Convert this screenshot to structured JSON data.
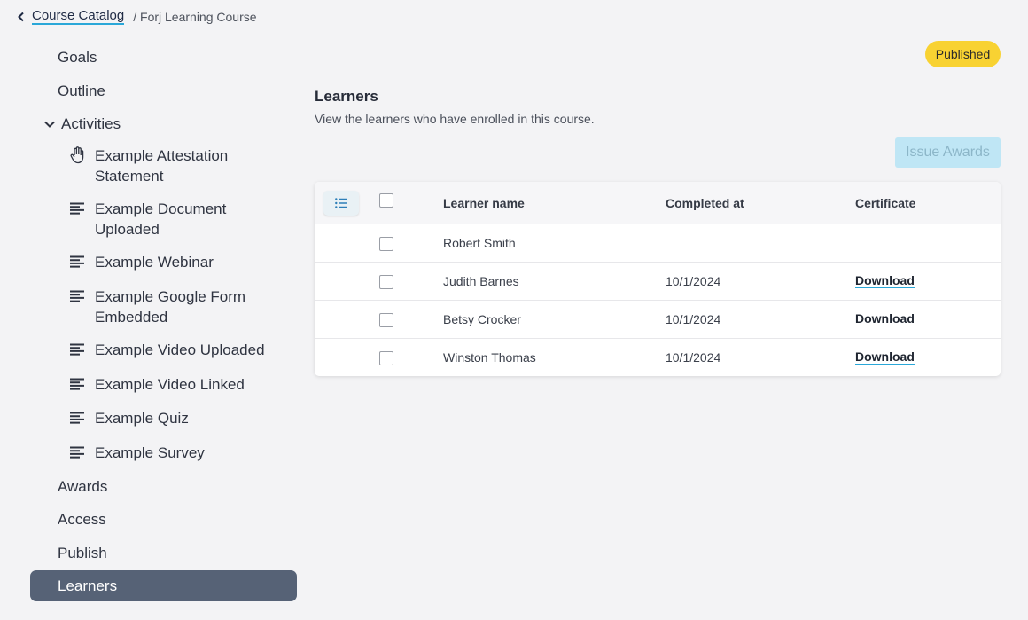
{
  "breadcrumb": {
    "parent": "Course Catalog",
    "current": "/ Forj Learning Course"
  },
  "status_badge": "Published",
  "nav": {
    "goals": "Goals",
    "outline": "Outline",
    "activities": "Activities",
    "activity_items": [
      "Example Attestation Statement",
      "Example Document Uploaded",
      "Example Webinar",
      "Example Google Form Embedded",
      "Example Video Uploaded",
      "Example Video Linked",
      "Example Quiz",
      "Example Survey"
    ],
    "awards": "Awards",
    "access": "Access",
    "publish": "Publish",
    "learners": "Learners"
  },
  "main": {
    "title": "Learners",
    "subtitle": "View the learners who have enrolled in this course.",
    "issue_awards": "Issue Awards"
  },
  "table": {
    "headers": [
      "Learner name",
      "Completed at",
      "Certificate"
    ],
    "rows": [
      {
        "name": "Robert Smith",
        "completed": "",
        "certificate": ""
      },
      {
        "name": "Judith Barnes",
        "completed": "10/1/2024",
        "certificate": "Download"
      },
      {
        "name": "Betsy Crocker",
        "completed": "10/1/2024",
        "certificate": "Download"
      },
      {
        "name": "Winston Thomas",
        "completed": "10/1/2024",
        "certificate": "Download"
      }
    ]
  },
  "colors": {
    "accent": "#2aa7d8",
    "active_nav": "#566276",
    "badge": "#f8d232",
    "award_button": "#bfe6f5"
  }
}
